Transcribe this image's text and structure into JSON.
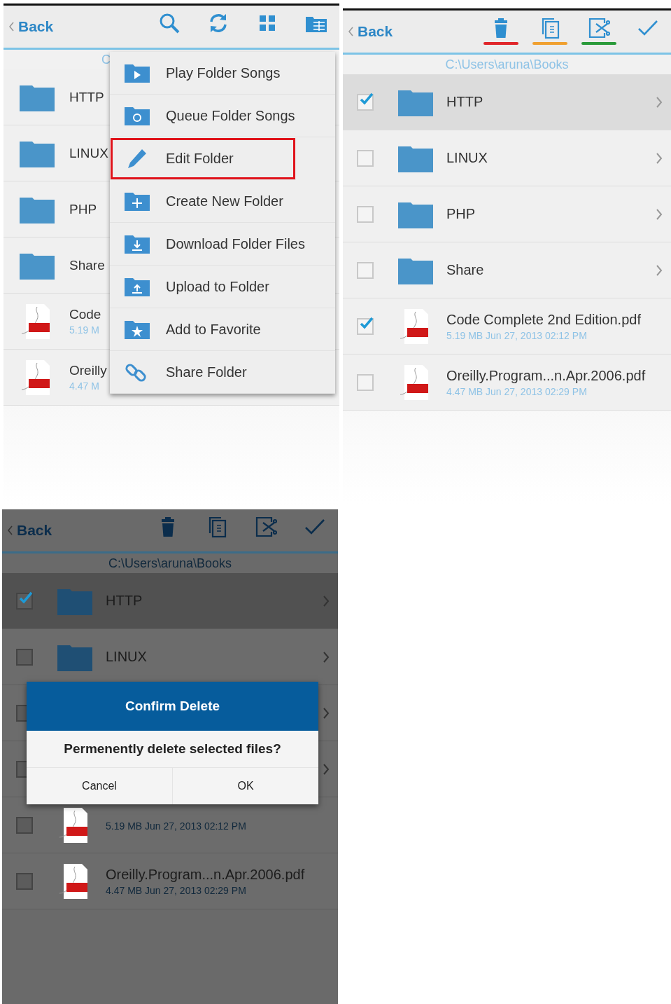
{
  "screens": [
    {
      "kind": "browse",
      "dimmed": false,
      "back": "Back",
      "toolbar": [
        {
          "kind": "search"
        },
        {
          "kind": "refresh"
        },
        {
          "kind": "grid"
        },
        {
          "kind": "folder-menu"
        }
      ],
      "path": "C",
      "rows": [
        {
          "kind": "folder",
          "name": "HTTP"
        },
        {
          "kind": "folder",
          "name": "LINUX"
        },
        {
          "kind": "folder",
          "name": "PHP"
        },
        {
          "kind": "folder",
          "name": "Share"
        },
        {
          "kind": "pdf",
          "name": "Code",
          "meta": "5.19 M"
        },
        {
          "kind": "pdf",
          "name": "Oreilly",
          "meta": "4.47 M"
        }
      ],
      "menu": [
        {
          "kind": "play",
          "label": "Play Folder Songs",
          "highlighted": false
        },
        {
          "kind": "queue",
          "label": "Queue Folder Songs",
          "highlighted": false
        },
        {
          "kind": "edit",
          "label": "Edit Folder",
          "highlighted": true
        },
        {
          "kind": "create",
          "label": "Create New Folder",
          "highlighted": false
        },
        {
          "kind": "download",
          "label": "Download Folder Files",
          "highlighted": false
        },
        {
          "kind": "upload",
          "label": "Upload to Folder",
          "highlighted": false
        },
        {
          "kind": "favorite",
          "label": "Add to Favorite",
          "highlighted": false
        },
        {
          "kind": "share",
          "label": "Share Folder",
          "highlighted": false
        }
      ]
    },
    {
      "kind": "select",
      "dimmed": false,
      "back": "Back",
      "toolbar": [
        {
          "kind": "trash",
          "color": "#e0262a"
        },
        {
          "kind": "copy",
          "color": "#f0a030"
        },
        {
          "kind": "cut",
          "color": "#2a9a3a"
        },
        {
          "kind": "check"
        }
      ],
      "path": "C:\\Users\\aruna\\Books",
      "rows": [
        {
          "kind": "folder",
          "name": "HTTP",
          "checked": true,
          "selected": true
        },
        {
          "kind": "folder",
          "name": "LINUX",
          "checked": false,
          "selected": false
        },
        {
          "kind": "folder",
          "name": "PHP",
          "checked": false,
          "selected": false
        },
        {
          "kind": "folder",
          "name": "Share",
          "checked": false,
          "selected": false
        },
        {
          "kind": "pdf",
          "name": "Code Complete 2nd Edition.pdf",
          "meta": "5.19 MB  Jun 27, 2013 02:12 PM",
          "checked": true,
          "selected": false
        },
        {
          "kind": "pdf",
          "name": "Oreilly.Program...n.Apr.2006.pdf",
          "meta": "4.47 MB  Jun 27, 2013 02:29 PM",
          "checked": false,
          "selected": false
        }
      ]
    },
    {
      "kind": "select",
      "dimmed": true,
      "back": "Back",
      "toolbar": [
        {
          "kind": "trash"
        },
        {
          "kind": "copy"
        },
        {
          "kind": "cut"
        },
        {
          "kind": "check"
        }
      ],
      "path": "C:\\Users\\aruna\\Books",
      "rows": [
        {
          "kind": "folder",
          "name": "HTTP",
          "checked": true,
          "selected": true
        },
        {
          "kind": "folder",
          "name": "LINUX",
          "checked": false,
          "selected": false
        },
        {
          "kind": "folder",
          "selected": false
        },
        {
          "kind": "folder",
          "selected": false
        },
        {
          "kind": "pdf",
          "meta": "5.19 MB  Jun 27, 2013 02:12 PM",
          "selected": false
        },
        {
          "kind": "pdf",
          "name": "Oreilly.Program...n.Apr.2006.pdf",
          "meta": "4.47 MB  Jun 27, 2013 02:29 PM",
          "checked": false,
          "selected": false
        }
      ],
      "dialog": {
        "title": "Confirm Delete",
        "message": "Permenently delete selected files?",
        "buttons": [
          "Cancel",
          "OK"
        ]
      }
    }
  ]
}
